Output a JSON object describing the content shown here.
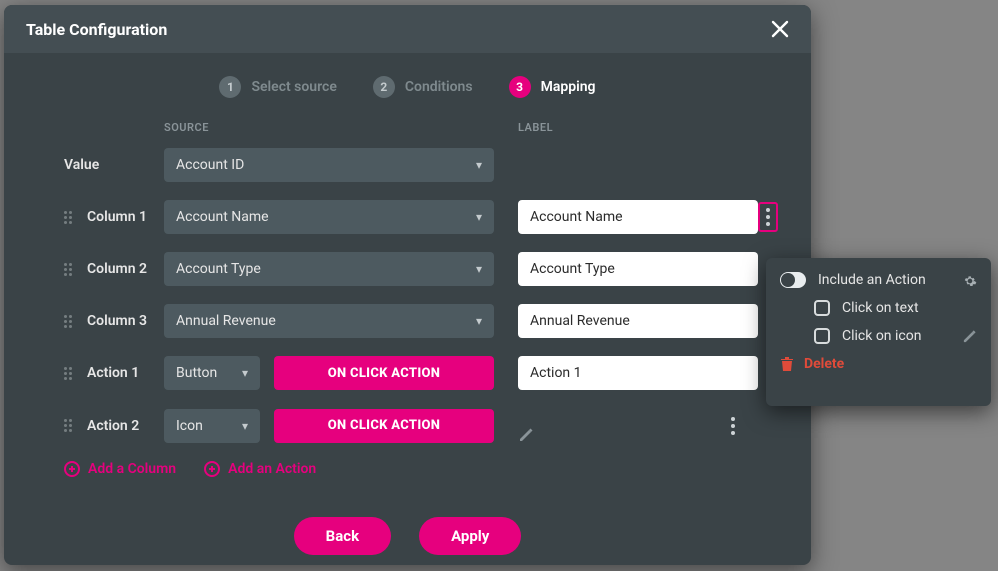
{
  "modal": {
    "title": "Table Configuration",
    "steps": [
      {
        "num": "1",
        "label": "Select source",
        "active": false
      },
      {
        "num": "2",
        "label": "Conditions",
        "active": false
      },
      {
        "num": "3",
        "label": "Mapping",
        "active": true
      }
    ],
    "headers": {
      "source": "SOURCE",
      "label": "LABEL"
    },
    "rows": {
      "value": {
        "name": "Value",
        "source": "Account ID"
      },
      "columns": [
        {
          "name": "Column 1",
          "source": "Account Name",
          "label": "Account Name"
        },
        {
          "name": "Column 2",
          "source": "Account Type",
          "label": "Account Type"
        },
        {
          "name": "Column 3",
          "source": "Annual Revenue",
          "label": "Annual Revenue"
        }
      ],
      "actions": [
        {
          "name": "Action 1",
          "type": "Button",
          "button": "ON CLICK ACTION",
          "label": "Action 1"
        },
        {
          "name": "Action 2",
          "type": "Icon",
          "button": "ON CLICK ACTION"
        }
      ]
    },
    "add": {
      "column": "Add a Column",
      "action": "Add an Action"
    },
    "footer": {
      "back": "Back",
      "apply": "Apply"
    }
  },
  "popover": {
    "include": "Include an Action",
    "click_text": "Click on text",
    "click_icon": "Click on icon",
    "delete": "Delete"
  }
}
